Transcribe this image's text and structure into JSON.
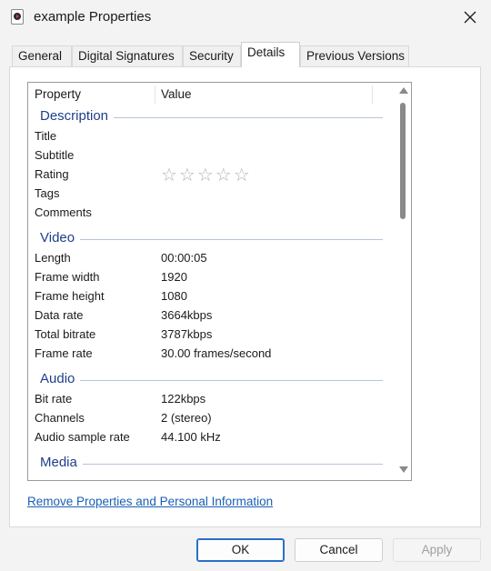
{
  "window": {
    "title": "example Properties",
    "icon": "media-file-icon",
    "close_icon": "close-icon"
  },
  "tabs": [
    {
      "label": "General"
    },
    {
      "label": "Digital Signatures"
    },
    {
      "label": "Security"
    },
    {
      "label": "Details",
      "active": true
    },
    {
      "label": "Previous Versions"
    }
  ],
  "details": {
    "header": {
      "property": "Property",
      "value": "Value"
    },
    "groups": {
      "description": {
        "title": "Description",
        "rows": [
          {
            "key": "Title",
            "value": ""
          },
          {
            "key": "Subtitle",
            "value": ""
          },
          {
            "key": "Rating",
            "value": "☆☆☆☆☆",
            "rating": 0
          },
          {
            "key": "Tags",
            "value": ""
          },
          {
            "key": "Comments",
            "value": ""
          }
        ]
      },
      "video": {
        "title": "Video",
        "rows": [
          {
            "key": "Length",
            "value": "00:00:05"
          },
          {
            "key": "Frame width",
            "value": "1920"
          },
          {
            "key": "Frame height",
            "value": "1080"
          },
          {
            "key": "Data rate",
            "value": "3664kbps"
          },
          {
            "key": "Total bitrate",
            "value": "3787kbps"
          },
          {
            "key": "Frame rate",
            "value": "30.00 frames/second"
          }
        ]
      },
      "audio": {
        "title": "Audio",
        "rows": [
          {
            "key": "Bit rate",
            "value": "122kbps"
          },
          {
            "key": "Channels",
            "value": "2 (stereo)"
          },
          {
            "key": "Audio sample rate",
            "value": "44.100 kHz"
          }
        ]
      },
      "media": {
        "title": "Media",
        "rows": []
      }
    }
  },
  "remove_link": "Remove Properties and Personal Information",
  "buttons": {
    "ok": "OK",
    "cancel": "Cancel",
    "apply": "Apply"
  }
}
